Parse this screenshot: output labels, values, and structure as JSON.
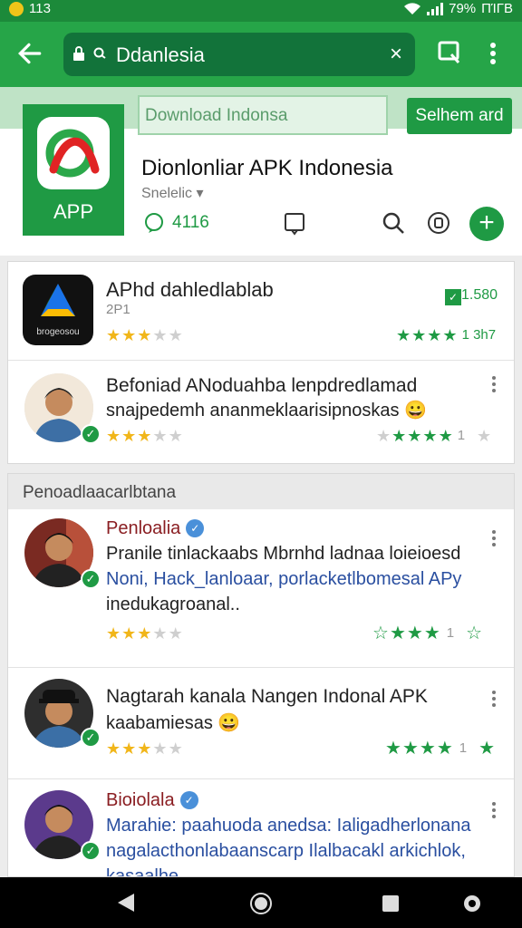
{
  "status": {
    "time": "113",
    "battery": "79%",
    "extra": "ΠΊΓΒ"
  },
  "toolbar": {
    "url": "Ddanlesia",
    "clear": "×"
  },
  "header": {
    "search_placeholder": "Download Indonsa",
    "search_button": "Selhem ard",
    "logo_label": "APP",
    "title": "Dionlonliar APK Indonesia",
    "subtitle": "Snelelic",
    "comments": "4116"
  },
  "colors": {
    "brand": "#26a548",
    "brand_dark": "#12733a",
    "accent": "#1f9a44",
    "star": "#f1b61a"
  },
  "apps": [
    {
      "title": "APhd dahledlablab",
      "sub": "2P1",
      "badge": "1.580",
      "rating_text": "1 3h7",
      "logo_text": "brogeosou",
      "icon": "drive-style-app-icon",
      "stars_left": [
        1,
        1,
        1,
        0,
        0
      ],
      "stars_right": [
        "g",
        "g",
        "g",
        "g"
      ]
    },
    {
      "title": "Befoniad ANoduahba lenpdredlamad",
      "line2": "snajpedemh ananmeklaarisipnoskas 😀",
      "rating_text": "1",
      "stars_left": [
        1,
        1,
        1,
        0,
        0
      ],
      "stars_right": [
        "o",
        "g",
        "g",
        "g",
        "g"
      ]
    }
  ],
  "section": {
    "title": "Penoadlaacarlbtana"
  },
  "reviews": [
    {
      "name": "Penloalia",
      "verified": true,
      "line1": "Pranile tinlackaabs Mbrnhd ladnaa loieioesd",
      "line2": "Noni, Hack_lanloaar, porlacketlbomesal APy",
      "line3": "inedukagroanal..",
      "stars_left": [
        1,
        1,
        1,
        0,
        0
      ],
      "stars_right": [
        "o",
        "g",
        "g",
        "g"
      ],
      "rating_text": "1"
    },
    {
      "name": "",
      "verified": false,
      "line1": "Nagtarah kanala Nangen Indonal APK",
      "line2": "kaabamiesas 😀",
      "line3": "",
      "stars_left": [
        1,
        1,
        1,
        0,
        0
      ],
      "stars_right": [
        "g",
        "g",
        "g",
        "g"
      ],
      "rating_text": "1"
    },
    {
      "name": "Bioiolala",
      "verified": true,
      "line1": "Marahie: paahuoda anedsa: Ialigadherlonana",
      "line2": "nagalacthonlabaanscarp Ilalbacakl arkichlok,",
      "line3": "kasaalhe..."
    }
  ]
}
